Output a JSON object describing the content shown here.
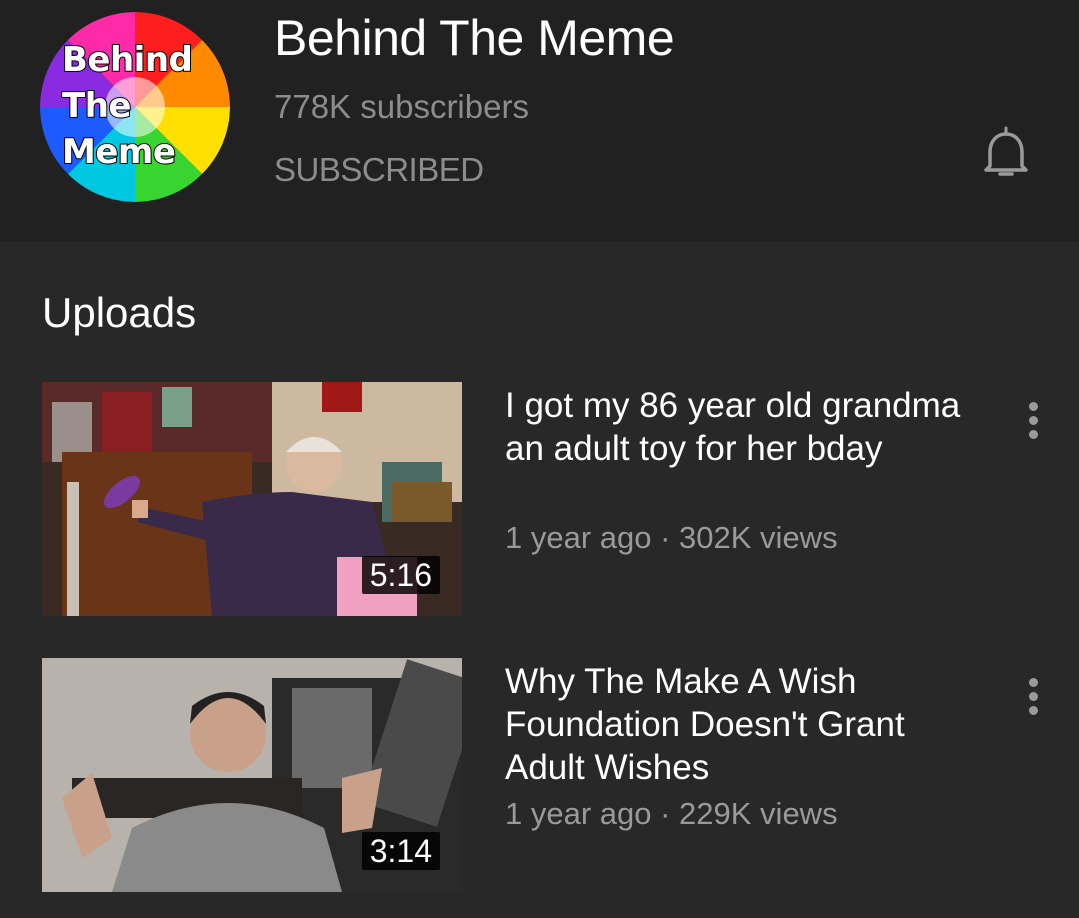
{
  "channel": {
    "avatar_lines": [
      "Behind",
      "The",
      "Meme"
    ],
    "title": "Behind The Meme",
    "subscribers": "778K subscribers",
    "subscribe_state": "SUBSCRIBED",
    "bell_icon": "bell-icon"
  },
  "uploads": {
    "section_title": "Uploads",
    "videos": [
      {
        "title": "I got my 86 year old grandma an adult toy for her bday",
        "meta": "1 year ago · 302K views",
        "duration": "5:16",
        "menu_icon": "more-vert-icon"
      },
      {
        "title": "Why The Make A Wish Foundation Doesn't Grant Adult Wishes",
        "meta": "1 year ago · 229K views",
        "duration": "3:14",
        "menu_icon": "more-vert-icon"
      }
    ]
  },
  "colors": {
    "header_bg": "#212121",
    "page_bg": "#282828",
    "primary_text": "#ffffff",
    "secondary_text": "#8c8c8c"
  }
}
